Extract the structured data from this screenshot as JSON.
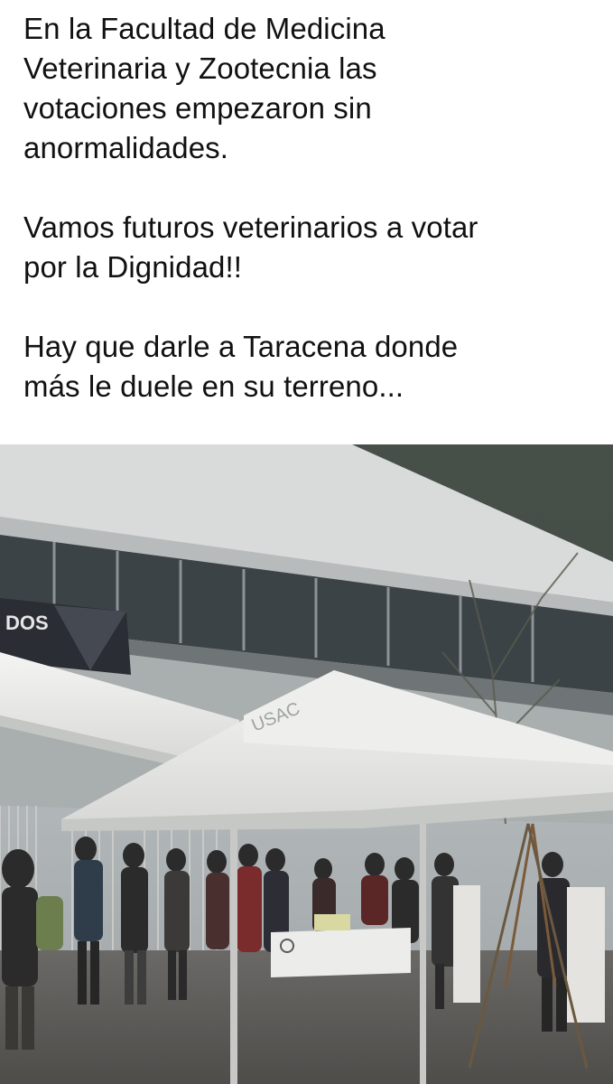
{
  "post": {
    "paragraphs": [
      "En la Facultad de Medicina\nVeterinaria y Zootecnia las\nvotaciones empezaron sin\nanormalidades.",
      "Vamos futuros veterinarios a votar\npor la Dignidad!!",
      "Hay que darle a Taracena donde\nmás le duele en su terreno..."
    ]
  },
  "photo": {
    "banner_text": "DOS",
    "tent_logo_text": "USAC"
  }
}
